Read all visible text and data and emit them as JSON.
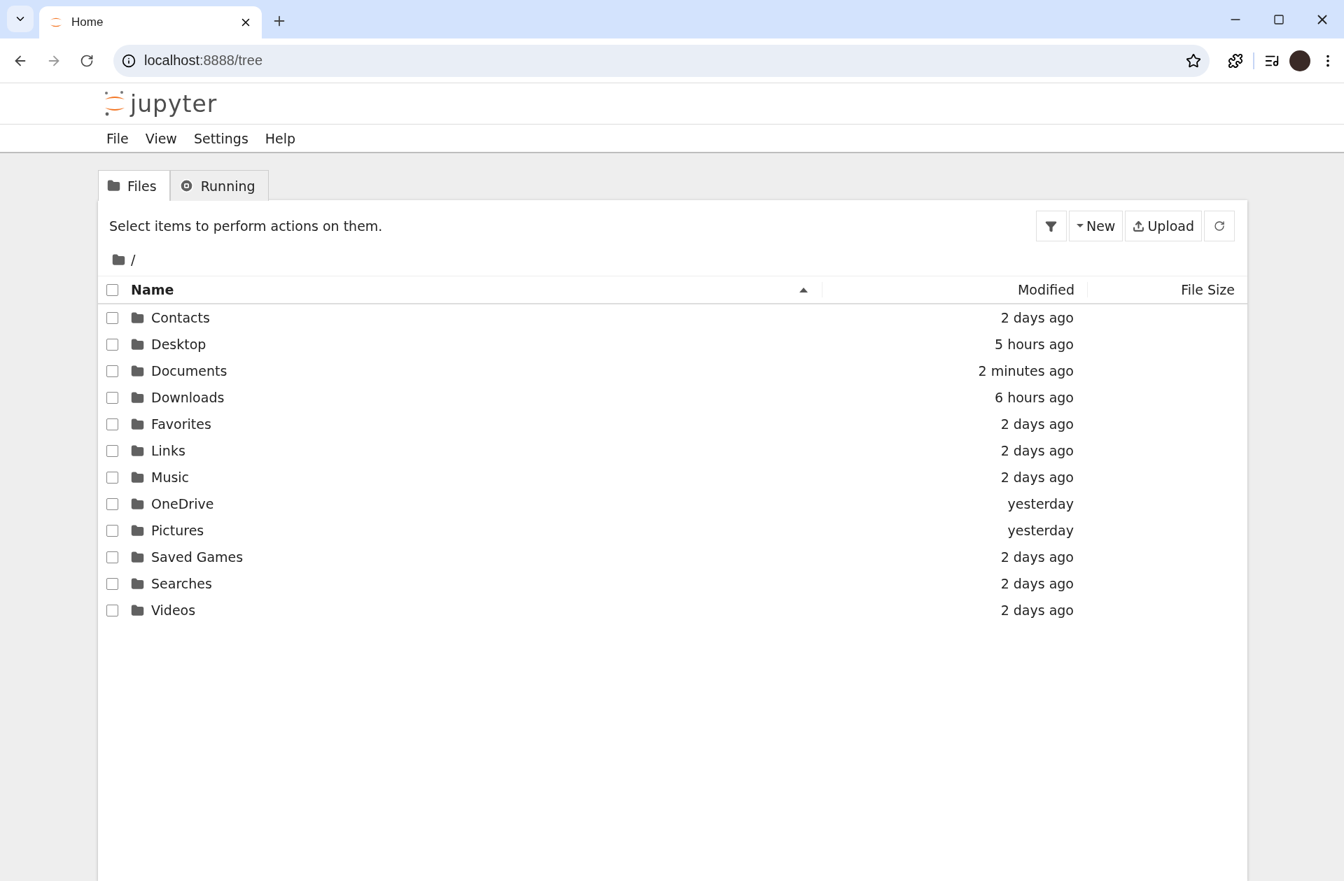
{
  "browser": {
    "tab_title": "Home",
    "url_host": "localhost",
    "url_path": ":8888/tree"
  },
  "app": {
    "logo_text": "jupyter",
    "menu": [
      "File",
      "View",
      "Settings",
      "Help"
    ]
  },
  "tabs": [
    {
      "label": "Files",
      "kind": "folder",
      "selected": true
    },
    {
      "label": "Running",
      "kind": "running",
      "selected": false
    }
  ],
  "toolbar": {
    "hint": "Select items to perform actions on them.",
    "buttons": [
      {
        "kind": "filter"
      },
      {
        "kind": "new",
        "label": "New"
      },
      {
        "kind": "upload",
        "label": "Upload"
      },
      {
        "kind": "refresh"
      }
    ]
  },
  "breadcrumb": "/",
  "table": {
    "columns": [
      "Name",
      "Modified",
      "File Size"
    ],
    "all_checked": false,
    "rows": [
      {
        "name": "Contacts",
        "modified": "2 days ago",
        "checked": false
      },
      {
        "name": "Desktop",
        "modified": "5 hours ago",
        "checked": false
      },
      {
        "name": "Documents",
        "modified": "2 minutes ago",
        "checked": false
      },
      {
        "name": "Downloads",
        "modified": "6 hours ago",
        "checked": false
      },
      {
        "name": "Favorites",
        "modified": "2 days ago",
        "checked": false
      },
      {
        "name": "Links",
        "modified": "2 days ago",
        "checked": false
      },
      {
        "name": "Music",
        "modified": "2 days ago",
        "checked": false
      },
      {
        "name": "OneDrive",
        "modified": "yesterday",
        "checked": false
      },
      {
        "name": "Pictures",
        "modified": "yesterday",
        "checked": false
      },
      {
        "name": "Saved Games",
        "modified": "2 days ago",
        "checked": false
      },
      {
        "name": "Searches",
        "modified": "2 days ago",
        "checked": false
      },
      {
        "name": "Videos",
        "modified": "2 days ago",
        "checked": false
      }
    ]
  }
}
